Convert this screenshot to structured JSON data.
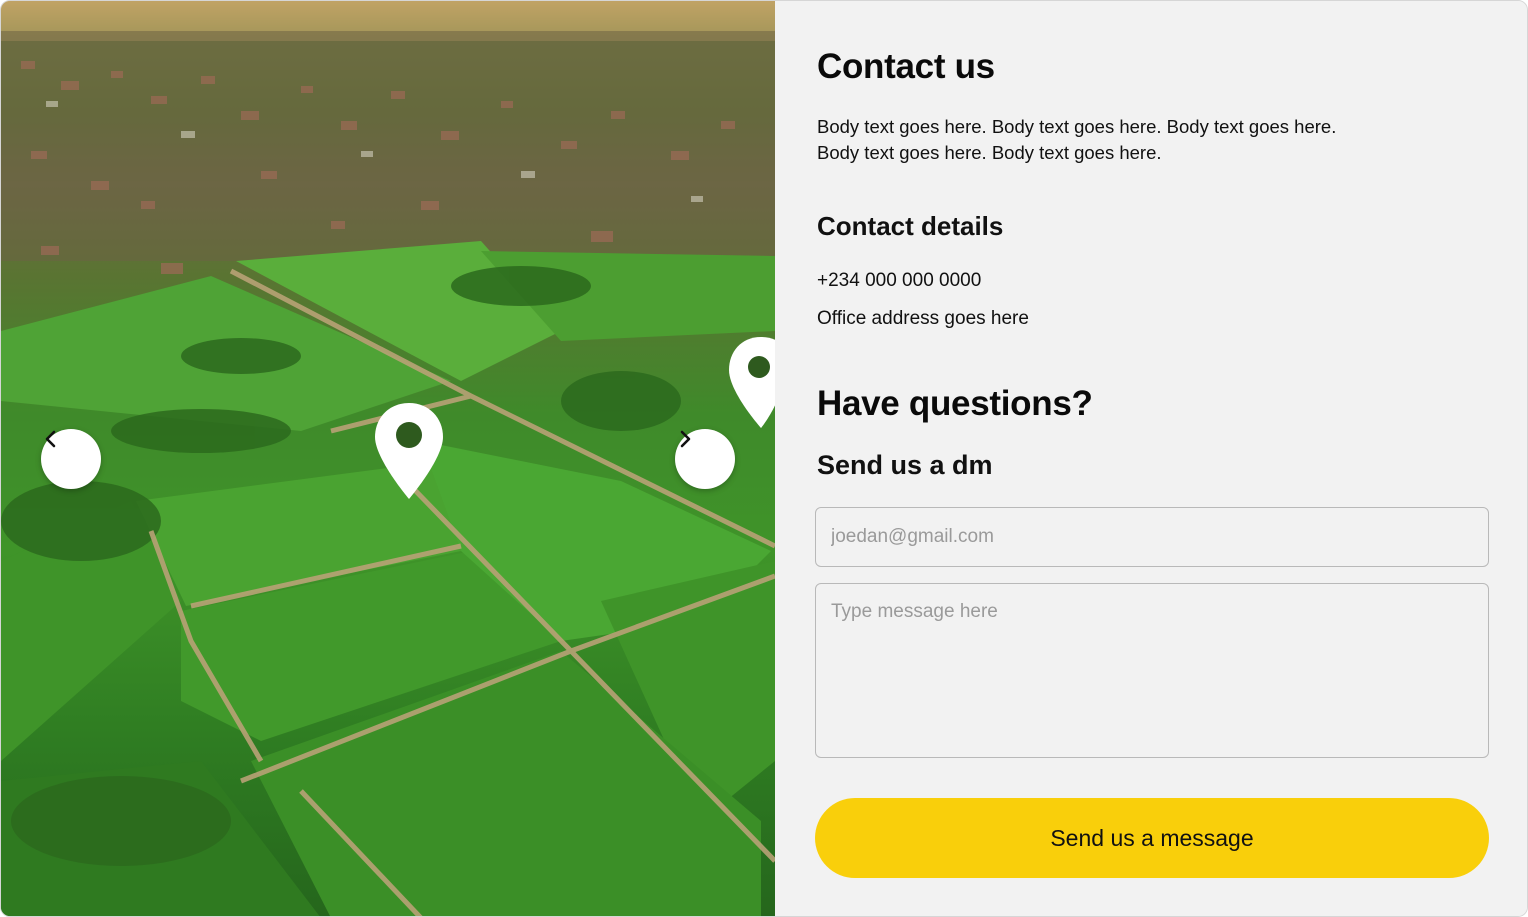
{
  "colors": {
    "panel_background": "#f2f2f2",
    "accent": "#f9cf0b",
    "text": "#0a0a0a",
    "placeholder": "#9a9a9a"
  },
  "carousel": {
    "image": "aerial-farmland-with-location-pins",
    "prev_icon": "chevron-left-icon",
    "next_icon": "chevron-right-icon"
  },
  "contact": {
    "title": "Contact us",
    "body": "Body text goes here. Body text goes here. Body text goes here. Body text goes here. Body text goes here.",
    "details_heading": "Contact details",
    "phone": "+234 000 000 0000",
    "address": "Office address goes here"
  },
  "questions": {
    "heading": "Have questions?",
    "subheading": "Send us a dm",
    "email_placeholder": "joedan@gmail.com",
    "message_placeholder": "Type message here",
    "submit_label": "Send us a message"
  }
}
